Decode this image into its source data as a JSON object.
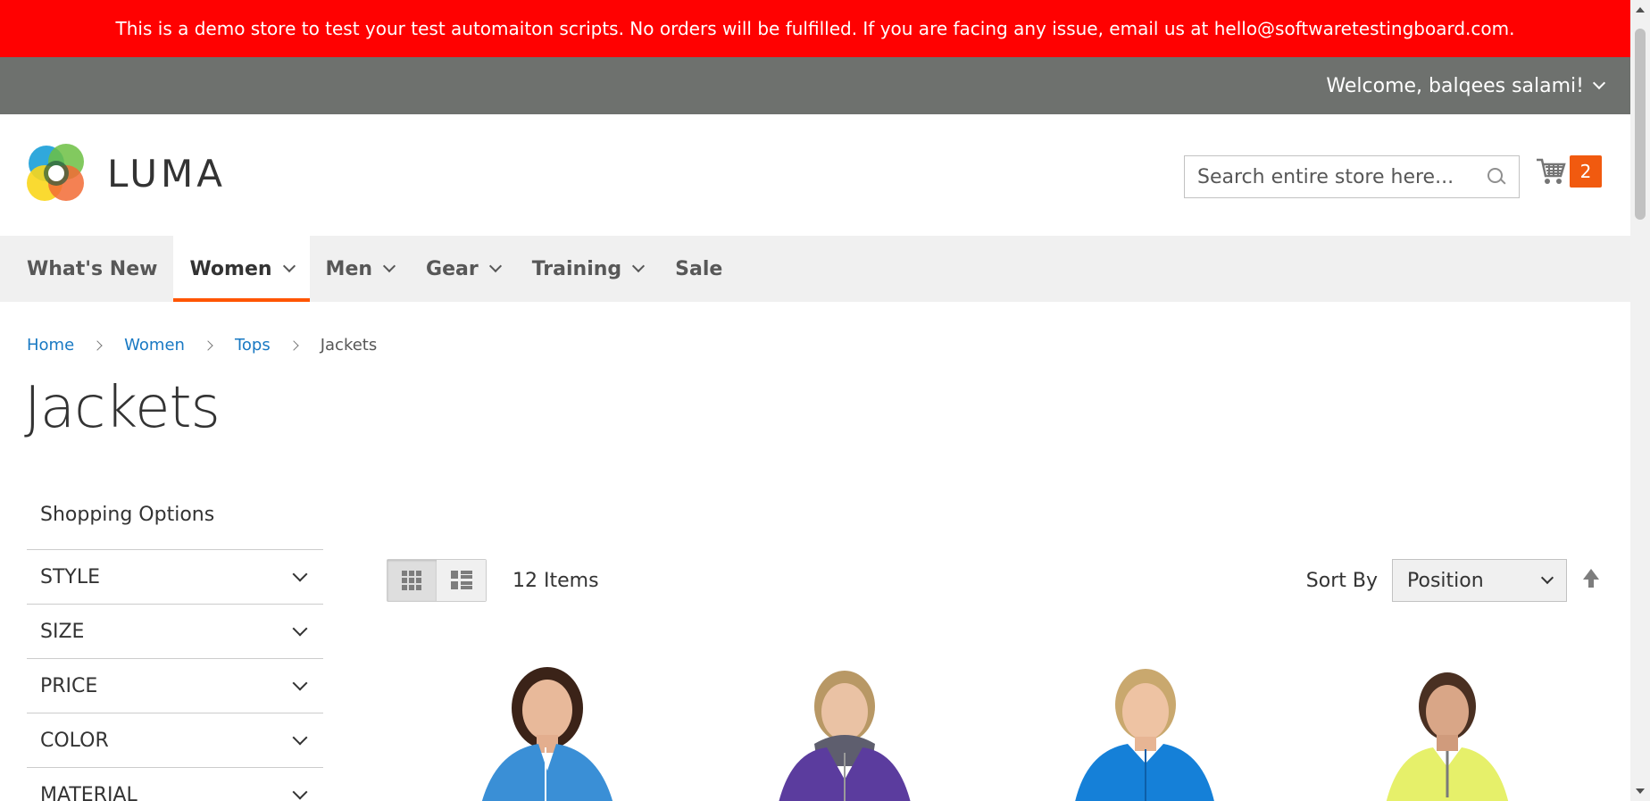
{
  "demo_notice": "This is a demo store to test your test automaiton scripts. No orders will be fulfilled. If you are facing any issue, email us at hello@softwaretestingboard.com.",
  "panel_header": {
    "welcome": "Welcome, balqees salami!"
  },
  "header": {
    "logo_text": "LUMA",
    "search": {
      "placeholder": "Search entire store here...",
      "value": ""
    },
    "cart": {
      "count": "2"
    }
  },
  "nav": {
    "items": [
      {
        "label": "What's New",
        "has_dropdown": false
      },
      {
        "label": "Women",
        "has_dropdown": true,
        "active": true
      },
      {
        "label": "Men",
        "has_dropdown": true
      },
      {
        "label": "Gear",
        "has_dropdown": true
      },
      {
        "label": "Training",
        "has_dropdown": true
      },
      {
        "label": "Sale",
        "has_dropdown": false
      }
    ]
  },
  "breadcrumbs": {
    "items": [
      "Home",
      "Women",
      "Tops"
    ],
    "current": "Jackets"
  },
  "page_title": "Jackets",
  "sidebar": {
    "title": "Shopping Options",
    "filters": [
      "STYLE",
      "SIZE",
      "PRICE",
      "COLOR",
      "MATERIAL"
    ]
  },
  "toolbar": {
    "amount": "12 Items",
    "sort_label": "Sort By",
    "sort_value": "Position",
    "view_mode": "grid"
  },
  "products": [
    {
      "name": "jacket-blue",
      "color": "#3a8fd6"
    },
    {
      "name": "jacket-purple",
      "color": "#5b3c9e"
    },
    {
      "name": "jacket-bright-blue",
      "color": "#1580d8"
    },
    {
      "name": "jacket-lime",
      "color": "#e6f06a"
    }
  ],
  "colors": {
    "demo_bar": "#ff0101",
    "panel_header": "#6e716e",
    "accent": "#ff5501",
    "link": "#1979c3",
    "cart_badge": "#f15a0f"
  }
}
